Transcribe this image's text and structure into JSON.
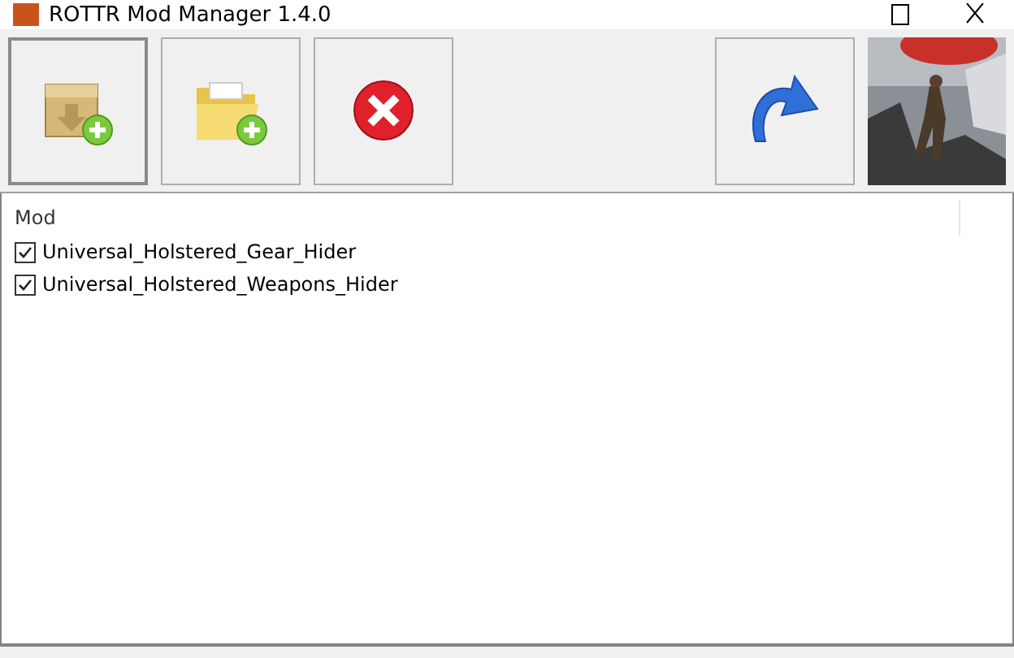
{
  "window": {
    "title": "ROTTR Mod Manager 1.4.0"
  },
  "toolbar": {
    "buttons": [
      {
        "kind": "install",
        "focused": true
      },
      {
        "kind": "add-folder",
        "focused": false
      },
      {
        "kind": "remove",
        "focused": false
      },
      {
        "kind": "refresh",
        "focused": false
      }
    ]
  },
  "mod_list": {
    "columns": [
      "Mod"
    ],
    "rows": [
      {
        "name": "Universal_Holstered_Gear_Hider",
        "checked": true
      },
      {
        "name": "Universal_Holstered_Weapons_Hider",
        "checked": true
      }
    ]
  }
}
